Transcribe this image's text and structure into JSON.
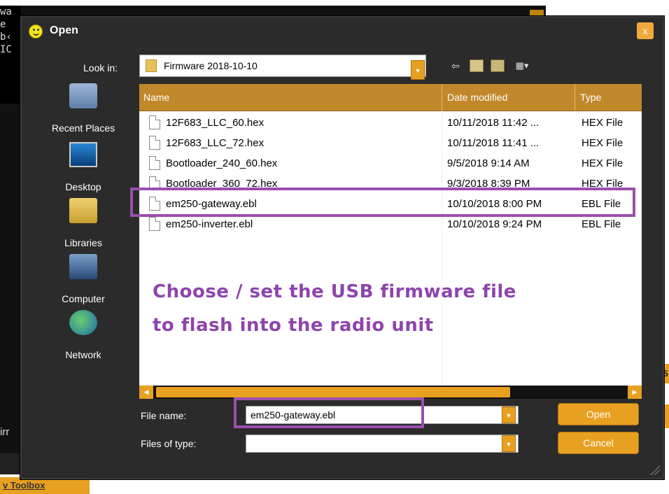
{
  "background": {
    "console_lines": [
      "wa",
      "e",
      "",
      "b‹",
      "IC"
    ],
    "left_label": "irr",
    "right_tab": "5",
    "toolbox_link": "v Toolbox"
  },
  "dialog": {
    "title": "Open",
    "close_label": "x",
    "look_in_label": "Look in:",
    "look_in_value": "Firmware 2018-10-10",
    "toolbar_icons": [
      "back-icon",
      "up-folder-icon",
      "new-folder-icon",
      "view-menu-icon"
    ],
    "places": [
      {
        "label": "Recent Places",
        "icon": "recent-places-icon"
      },
      {
        "label": "Desktop",
        "icon": "desktop-icon"
      },
      {
        "label": "Libraries",
        "icon": "libraries-icon"
      },
      {
        "label": "Computer",
        "icon": "computer-icon"
      },
      {
        "label": "Network",
        "icon": "network-icon"
      }
    ],
    "columns": [
      "Name",
      "Date modified",
      "Type"
    ],
    "files": [
      {
        "name": "12F683_LLC_60.hex",
        "date": "10/11/2018 11:42 ...",
        "type": "HEX File"
      },
      {
        "name": "12F683_LLC_72.hex",
        "date": "10/11/2018 11:41 ...",
        "type": "HEX File"
      },
      {
        "name": "Bootloader_240_60.hex",
        "date": "9/5/2018 9:14 AM",
        "type": "HEX File"
      },
      {
        "name": "Bootloader_360_72.hex",
        "date": "9/3/2018 8:39 PM",
        "type": "HEX File"
      },
      {
        "name": "em250-gateway.ebl",
        "date": "10/10/2018 8:00 PM",
        "type": "EBL File"
      },
      {
        "name": "em250-inverter.ebl",
        "date": "10/10/2018 9:24 PM",
        "type": "EBL File"
      }
    ],
    "annotation_line1": "Choose / set the USB firmware file",
    "annotation_line2": "to flash into the radio unit",
    "file_name_label": "File name:",
    "file_name_value": "em250-gateway.ebl",
    "files_of_type_label": "Files of type:",
    "files_of_type_value": "",
    "open_button": "Open",
    "cancel_button": "Cancel"
  },
  "colors": {
    "accent": "#e8a020",
    "highlight": "#9b4fae",
    "annotation": "#8e44ad"
  }
}
